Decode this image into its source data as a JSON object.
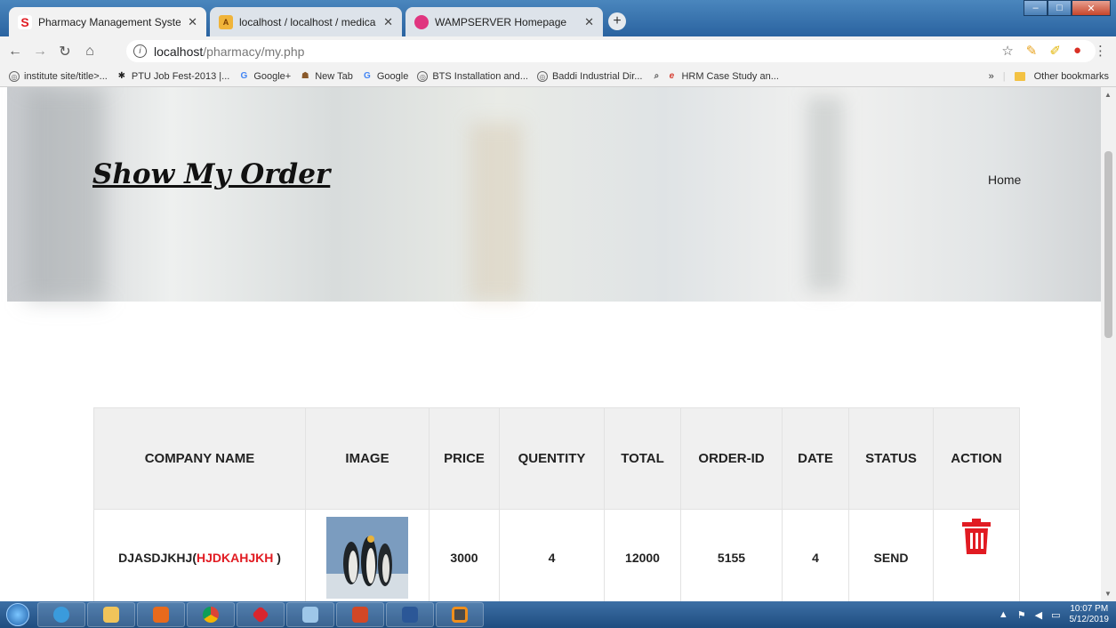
{
  "browser": {
    "tabs": [
      {
        "title": "Pharmacy Management System",
        "favicon": "S",
        "favicon_color": "#e11b22",
        "active": true
      },
      {
        "title": "localhost / localhost / medical / |",
        "favicon": "phpmyadmin-icon",
        "active": false
      },
      {
        "title": "WAMPSERVER Homepage",
        "favicon": "wamp-icon",
        "active": false
      }
    ],
    "url_host": "localhost",
    "url_path": "/pharmacy/my.php",
    "bookmarks": [
      "institute site/title>...",
      "PTU Job Fest-2013 |...",
      "Google+",
      "New Tab",
      "Google",
      "BTS Installation and...",
      "Baddi Industrial Dir...",
      "HRM Case Study an..."
    ],
    "other_bookmarks": "Other bookmarks",
    "overflow": "»"
  },
  "page": {
    "title": "Show My Order",
    "nav_home": "Home",
    "table": {
      "headers": [
        "COMPANY NAME",
        "IMAGE",
        "PRICE",
        "QUENTITY",
        "TOTAL",
        "ORDER-ID",
        "DATE",
        "STATUS",
        "ACTION"
      ],
      "rows": [
        {
          "company": "DJASDJKHJ(",
          "company_highlight": "HJDKAHJKH",
          "company_suffix": " )",
          "price": "3000",
          "quantity": "4",
          "total": "12000",
          "order_id": "5155",
          "date": "4",
          "status": "SEND"
        }
      ]
    }
  },
  "taskbar": {
    "time": "10:07 PM",
    "date": "5/12/2019"
  },
  "colors": {
    "accent_red": "#e11b22",
    "header_bg": "#f0f0f0"
  }
}
